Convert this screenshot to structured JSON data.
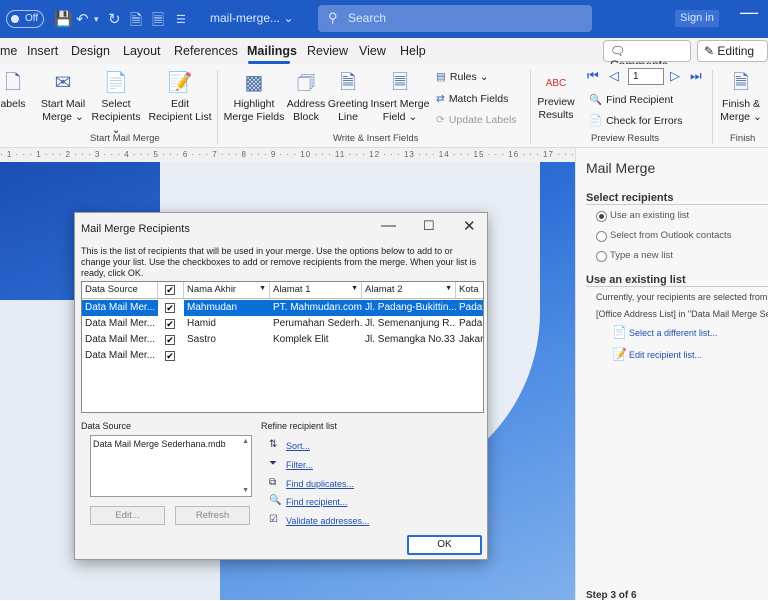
{
  "titlebar": {
    "autosave": "Off",
    "doc_title": "mail-merge...",
    "search_placeholder": "Search",
    "sign_in": "Sign in"
  },
  "menu": {
    "items": [
      "me",
      "Insert",
      "Design",
      "Layout",
      "References",
      "Mailings",
      "Review",
      "View",
      "Help"
    ],
    "comments": "Comments",
    "editing": "Editing"
  },
  "ribbon": {
    "labels": "abels",
    "start_mail_merge": [
      "Start Mail",
      "Merge"
    ],
    "select_recipients": [
      "Select",
      "Recipients"
    ],
    "edit_recipient_list": [
      "Edit",
      "Recipient List"
    ],
    "highlight_merge_fields": [
      "Highlight",
      "Merge Fields"
    ],
    "address_block": [
      "Address",
      "Block"
    ],
    "greeting_line": [
      "Greeting",
      "Line"
    ],
    "insert_merge_field": [
      "Insert Merge",
      "Field"
    ],
    "rules": "Rules",
    "match_fields": "Match Fields",
    "update_labels": "Update Labels",
    "preview_results": [
      "Preview",
      "Results"
    ],
    "abc": "ABC",
    "record_number": "1",
    "find_recipient": "Find Recipient",
    "check_for_errors": "Check for Errors",
    "finish_merge": [
      "Finish &",
      "Merge"
    ],
    "groups": {
      "start": "Start Mail Merge",
      "write_insert": "Write & Insert Fields",
      "preview": "Preview Results",
      "finish": "Finish"
    }
  },
  "ruler": "· 1 · · · 1 · · · 2 · · · 3 · · · 4 · · · 5 · · · 6 · · · 7 · · · 8 · · · 9 · · · 10 · · · 11 · · · 12 · · · 13 · · · 14 · · · 15 · · · 16 · · · 17 · · · 18 ·",
  "pane": {
    "title": "Mail Merge",
    "select_recipients": "Select recipients",
    "opt_existing": "Use an existing list",
    "opt_outlook": "Select from Outlook contacts",
    "opt_new": "Type a new list",
    "use_existing": "Use an existing list",
    "currently": "Currently, your recipients are selected from:",
    "source_line": "[Office Address List] in \"Data Mail Merge Se",
    "select_different": "Select a different list...",
    "edit_list": "Edit recipient list...",
    "step": "Step 3 of 6"
  },
  "dialog": {
    "title": "Mail Merge Recipients",
    "desc": [
      "This is the list of recipients that will be used in your merge.  Use the options below to add to or",
      "change your list.  Use the checkboxes to add or remove recipients from the merge.  When your list is",
      "ready, click OK."
    ],
    "columns": [
      "Data Source",
      "",
      "Nama Akhir",
      "Alamat 1",
      "Alamat 2",
      "Kota"
    ],
    "rows": [
      [
        "Data Mail Mer...",
        "✔",
        "Mahmudan",
        "PT. Mahmudan.com",
        "Jl. Padang-Bukittin...",
        "Padan"
      ],
      [
        "Data Mail Mer...",
        "✔",
        "Hamid",
        "Perumahan Sederh...",
        "Jl. Semenanjung R...",
        "Padan"
      ],
      [
        "Data Mail Mer...",
        "✔",
        "Sastro",
        "Komplek Elit",
        "Jl. Semangka No.33",
        "Jakart"
      ],
      [
        "Data Mail Mer...",
        "✔",
        "",
        "",
        "",
        ""
      ]
    ],
    "data_source_label": "Data Source",
    "data_source_item": "Data Mail Merge Sederhana.mdb",
    "edit_btn": "Edit...",
    "refresh_btn": "Refresh",
    "refine_label": "Refine recipient list",
    "links": [
      "Sort...",
      "Filter...",
      "Find duplicates...",
      "Find recipient...",
      "Validate addresses..."
    ],
    "ok": "OK"
  }
}
